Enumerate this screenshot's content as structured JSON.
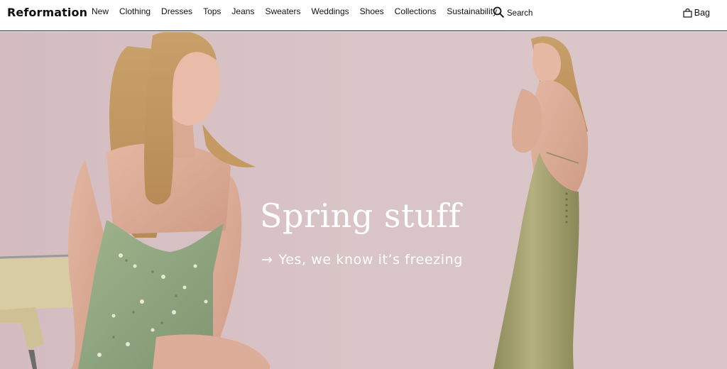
{
  "header": {
    "logo": "Reformation",
    "nav": [
      "New",
      "Clothing",
      "Dresses",
      "Tops",
      "Jeans",
      "Sweaters",
      "Weddings",
      "Shoes",
      "Collections",
      "Sustainability"
    ],
    "search_label": "Search",
    "bag_label": "Bag"
  },
  "hero": {
    "headline": "Spring stuff",
    "subline_arrow": "→",
    "subline": "Yes, we know it’s freezing"
  },
  "colors": {
    "background": "#d8c2c5",
    "dress_left": "#8fa47c",
    "dress_right": "#a4a070",
    "text_light": "#ffffff"
  },
  "icons": [
    "search-icon",
    "bag-icon",
    "arrow-right-icon"
  ]
}
